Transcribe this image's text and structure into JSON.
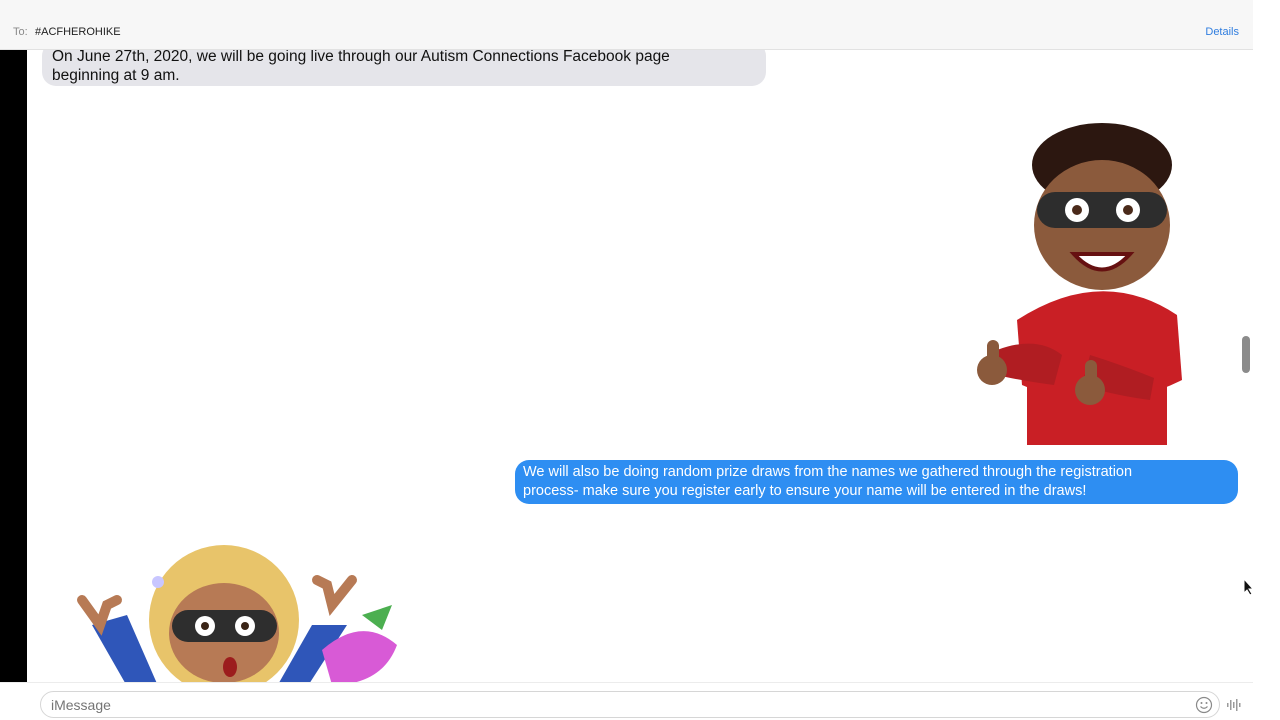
{
  "header": {
    "to_label": "To:",
    "recipient": "#ACFHEROHIKE",
    "details_label": "Details"
  },
  "messages": [
    {
      "direction": "received",
      "text_line1": "On June 27th, 2020, we will be going live through our Autism Connections Facebook page",
      "text_line2": "beginning at 9 am."
    },
    {
      "direction": "sent",
      "text_line1": "We will also be doing random prize draws from the names we gathered through the registration",
      "text_line2": "process- make sure you register early to ensure your name will be entered in the draws!"
    }
  ],
  "composer": {
    "placeholder": "iMessage"
  },
  "icons": {
    "emoji": "emoji-icon",
    "audio": "audio-wave-icon",
    "cursor": "mouse-pointer-icon"
  },
  "colors": {
    "sent_bubble": "#2e8ef2",
    "received_bubble": "#e5e5ea",
    "link": "#2f7ddf"
  }
}
